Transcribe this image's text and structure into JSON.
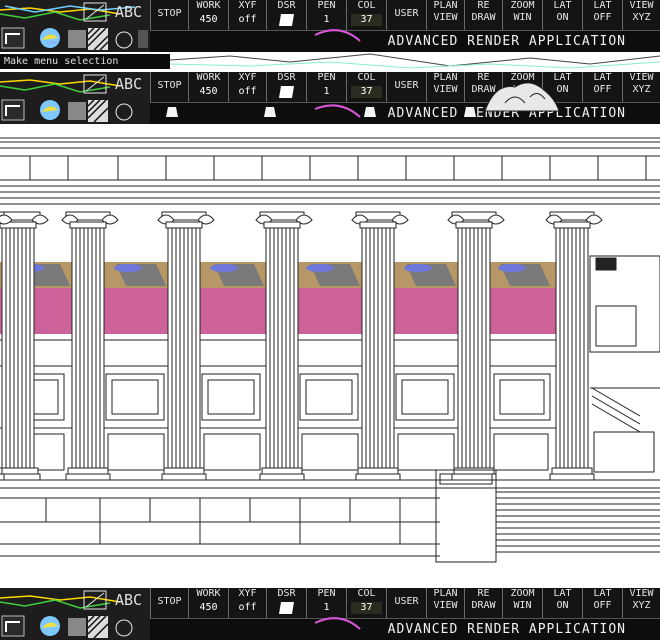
{
  "app": {
    "title": "ADVANCED RENDER APPLICATION"
  },
  "toolbar": {
    "stop_label": "STOP",
    "work": {
      "label": "WORK",
      "value": "450"
    },
    "xyf": {
      "label": "XYF",
      "value": "off"
    },
    "dsr": {
      "label": "DSR"
    },
    "pen": {
      "label": "PEN",
      "value": "1"
    },
    "col": {
      "label": "COL",
      "value": "37"
    },
    "user_label": "USER",
    "plan_view": {
      "line1": "PLAN",
      "line2": "VIEW"
    },
    "re_draw": {
      "line1": "RE",
      "line2": "DRAW"
    },
    "zoom_win": {
      "line1": "ZOOM",
      "line2": "WIN"
    },
    "lat_on": {
      "line1": "LAT",
      "line2": "ON"
    },
    "lat_off": {
      "line1": "LAT",
      "line2": "OFF"
    },
    "view_xyz": {
      "line1": "VIEW",
      "line2": "XYZ"
    },
    "abc_label": "ABC"
  },
  "message": {
    "text": "Make menu selection"
  },
  "colors": {
    "toolbar_bg": "#141414",
    "accent_magenta": "#d957d9",
    "frieze_pink": "#cc6299",
    "frieze_blue": "#6e78dc",
    "frieze_tan": "#c8a670"
  },
  "icons": [
    "pen-tool-icon",
    "globe-icon",
    "hatch-icon",
    "rect-icon",
    "circle-icon"
  ]
}
